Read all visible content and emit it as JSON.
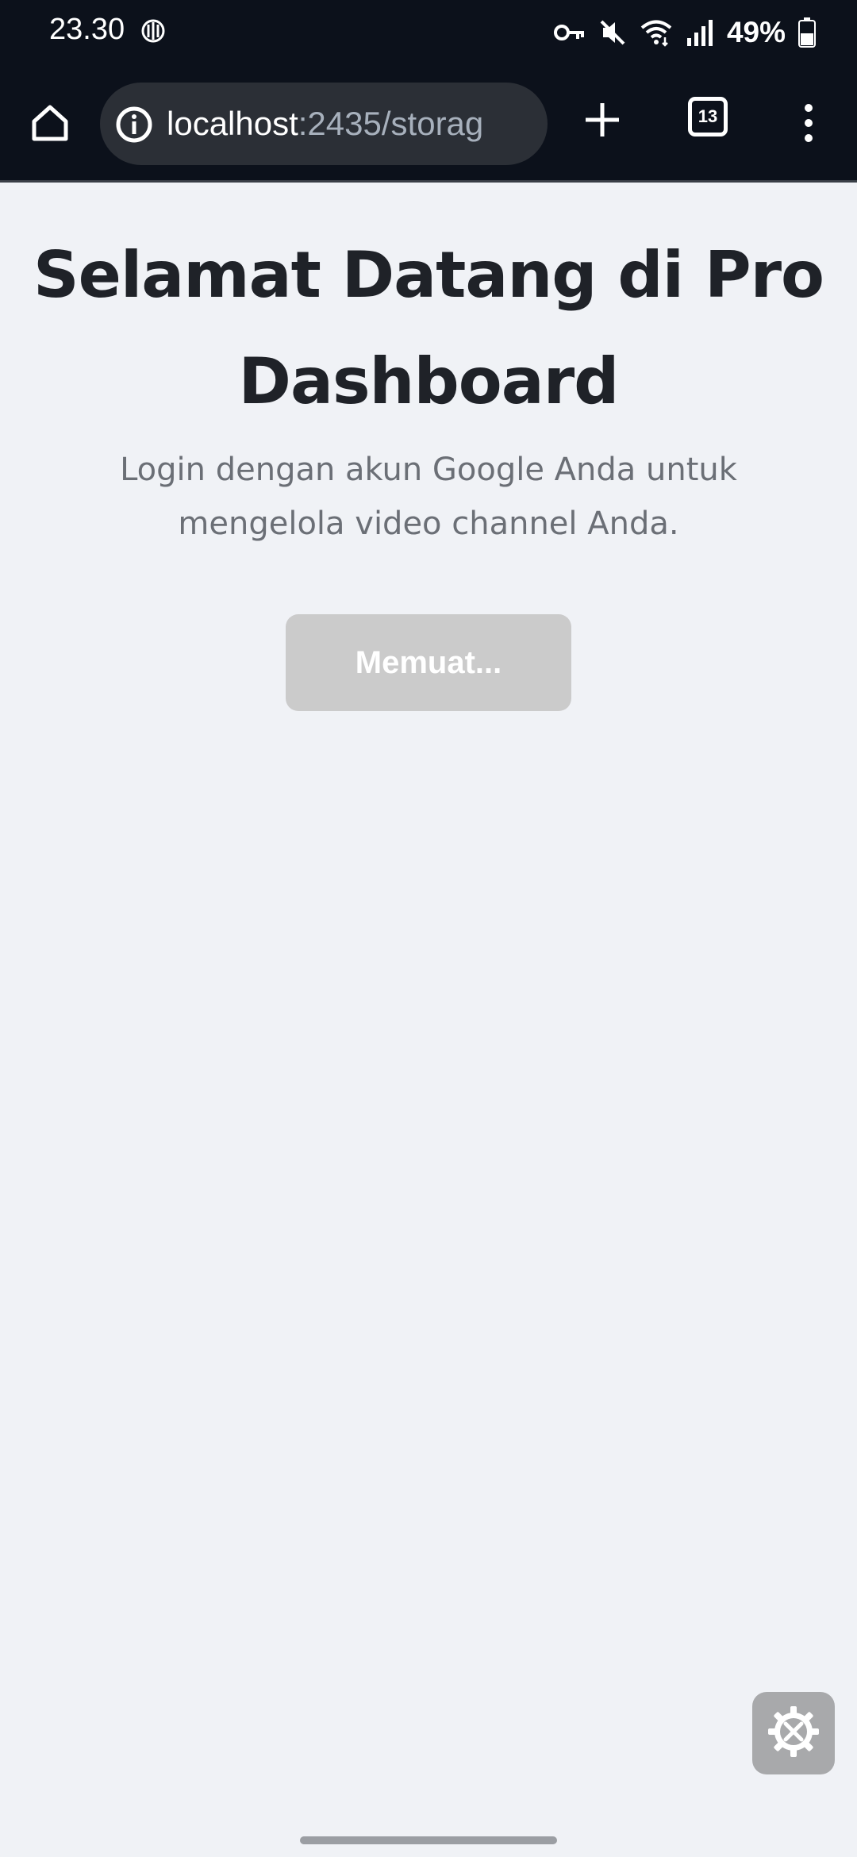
{
  "status_bar": {
    "time": "23.30",
    "battery_percent": "49%",
    "icons": [
      "vpn-key-icon",
      "mute-icon",
      "wifi-icon",
      "signal-icon",
      "battery-icon"
    ]
  },
  "browser": {
    "url_host": "localhost",
    "url_rest": ":2435/storag",
    "tab_count": "13",
    "icons": [
      "home-icon",
      "info-icon",
      "plus-icon",
      "tabs-icon",
      "more-vert-icon"
    ]
  },
  "main": {
    "title": "Selamat Datang di Pro Dashboard",
    "subtitle": "Login dengan akun Google Anda untuk mengelola video channel Anda.",
    "login_button_label": "Memuat..."
  },
  "colors": {
    "background": "#f0f2f6",
    "bar_background": "#0c111b",
    "title": "#1f2228",
    "subtitle": "#6b6f76",
    "button_disabled": "#cbcbcb"
  }
}
